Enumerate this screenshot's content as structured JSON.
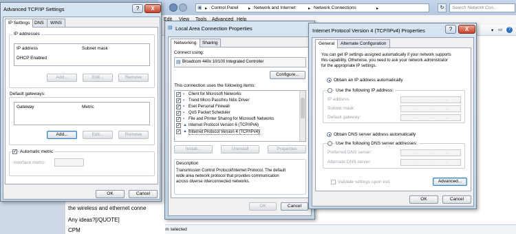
{
  "explorer": {
    "breadcrumb": [
      "Control Panel",
      "Network and Internet",
      "Network Connections"
    ],
    "search_placeholder": "Search Network Con...",
    "menu": [
      "Edit",
      "View",
      "Tools",
      "Advanced",
      "Help"
    ],
    "status": "1 item selected"
  },
  "forum": {
    "lines": [
      "the wireless and ethernet conne",
      "Any ideas?[/QUOTE]",
      "CPM"
    ]
  },
  "advanced_tcpip": {
    "title": "Advanced TCP/IP Settings",
    "tabs": [
      "IP Settings",
      "DNS",
      "WINS"
    ],
    "ip_group": "IP addresses",
    "ip_headers": [
      "IP address",
      "Subnet mask"
    ],
    "ip_rows": [
      "DHCP Enabled"
    ],
    "ip_buttons": [
      "Add...",
      "Edit...",
      "Remove"
    ],
    "gw_group": "Default gateways:",
    "gw_headers": [
      "Gateway",
      "Metric"
    ],
    "gw_buttons": [
      "Add...",
      "Edit...",
      "Remove"
    ],
    "auto_metric": "Automatic metric",
    "iface_metric": "Interface metric:",
    "ok": "OK",
    "cancel": "Cancel"
  },
  "lan_props": {
    "title": "Local Area Connection Properties",
    "tabs": [
      "Networking",
      "Sharing"
    ],
    "connect_using": "Connect using:",
    "adapter": "Broadcom 440x 10/100 Integrated Controller",
    "configure": "Configure...",
    "items_label": "This connection uses the following items:",
    "items": [
      "Client for Microsoft Networks",
      "Trend Micro Passthru Ndis Driver",
      "Eset Personal Firewall",
      "QoS Packet Scheduler",
      "File and Printer Sharing for Microsoft Networks",
      "Internet Protocol Version 6 (TCP/IPv6)",
      "Internet Protocol Version 4 (TCP/IPv4)"
    ],
    "buttons": [
      "Install...",
      "Uninstall",
      "Properties"
    ],
    "desc_label": "Description",
    "desc_text": [
      "Transmission Control Protocol/Internet Protocol. The default",
      "wide area network protocol that provides communication",
      "across diverse interconnected networks."
    ],
    "ok": "OK",
    "cancel": "Cancel"
  },
  "ipv4": {
    "title": "Internet Protocol Version 4 (TCP/IPv4) Properties",
    "tabs": [
      "General",
      "Alternate Configuration"
    ],
    "intro": [
      "You can get IP settings assigned automatically if your network supports",
      "this capability. Otherwise, you need to ask your network administrator",
      "for the appropriate IP settings."
    ],
    "obtain_ip": "Obtain an IP address automatically",
    "use_ip": "Use the following IP address:",
    "ip_fields": [
      "IP address:",
      "Subnet mask:",
      "Default gateway:"
    ],
    "obtain_dns": "Obtain DNS server address automatically",
    "use_dns": "Use the following DNS server addresses:",
    "dns_fields": [
      "Preferred DNS server:",
      "Alternate DNS server:"
    ],
    "validate": "Validate settings upon exit",
    "advanced": "Advanced...",
    "ok": "OK",
    "cancel": "Cancel",
    "help_glyph": "?",
    "close_glyph": "X"
  }
}
